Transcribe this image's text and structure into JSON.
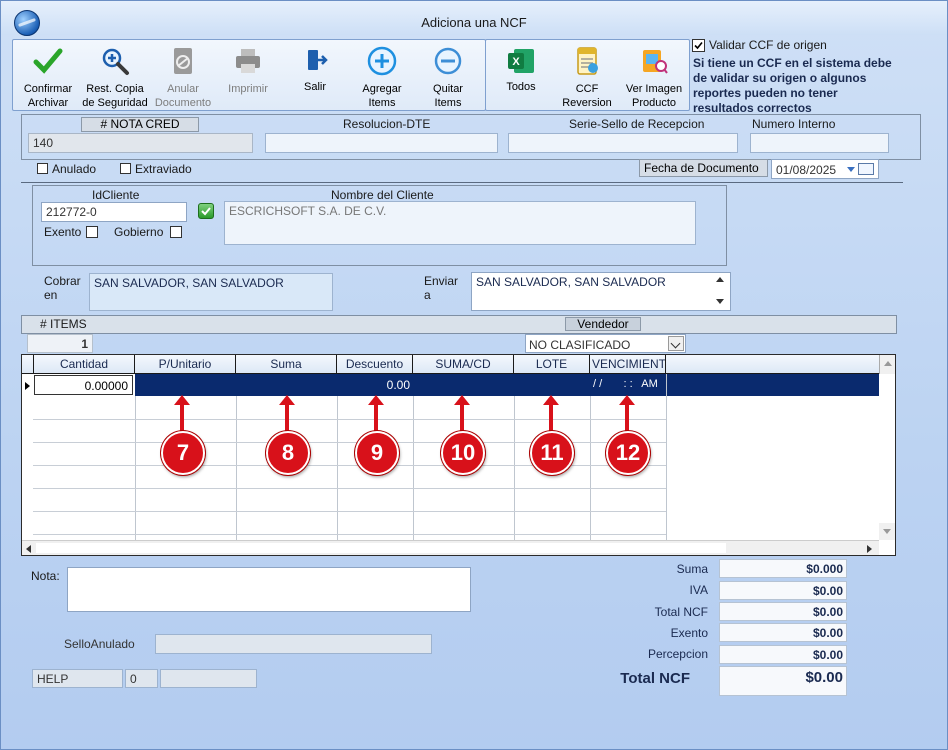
{
  "window": {
    "title": "Adiciona una NCF"
  },
  "toolbar": {
    "buttons": [
      {
        "label1": "Confirmar",
        "label2": "Archivar"
      },
      {
        "label1": "Rest. Copia",
        "label2": "de Seguridad"
      },
      {
        "label1": "Anular",
        "label2": "Documento"
      },
      {
        "label1": "Imprimir",
        "label2": ""
      },
      {
        "label1": "Salir",
        "label2": ""
      },
      {
        "label1": "Agregar",
        "label2": "Items"
      },
      {
        "label1": "Quitar",
        "label2": "Items"
      }
    ],
    "export_buttons": [
      {
        "label1": "Todos",
        "label2": ""
      },
      {
        "label1": "CCF",
        "label2": "Reversion"
      },
      {
        "label1": "Ver Imagen",
        "label2": "Producto"
      }
    ]
  },
  "validate": {
    "checkbox_label": "Validar CCF de origen",
    "warning": "Si tiene un CCF en el sistema debe de validar su origen o algunos reportes pueden no tener resultados correctos"
  },
  "doc": {
    "nota_label": "# NOTA CRED",
    "nota_value": "140",
    "resolucion_label": "Resolucion-DTE",
    "serie_label": "Serie-Sello de Recepcion",
    "numero_label": "Numero Interno",
    "anulado_label": "Anulado",
    "extraviado_label": "Extraviado",
    "fecha_label": "Fecha de  Documento",
    "fecha_value": "01/08/2025"
  },
  "client": {
    "id_label": "IdCliente",
    "id_value": "212772-0",
    "name_label": "Nombre del Cliente",
    "name_value": "ESCRICHSOFT S.A. DE C.V.",
    "exento_label": "Exento",
    "gobierno_label": "Gobierno",
    "cobrar_label1": "Cobrar",
    "cobrar_label2": "en",
    "cobrar_value": "SAN SALVADOR, SAN SALVADOR",
    "enviar_label1": "Enviar",
    "enviar_label2": "a",
    "enviar_value": "SAN SALVADOR, SAN SALVADOR"
  },
  "items_bar": {
    "items_label": "# ITEMS",
    "items_count": "1",
    "vendedor_label": "Vendedor",
    "vendedor_value": "NO CLASIFICADO"
  },
  "grid": {
    "columns": [
      "Cantidad",
      "P/Unitario",
      "Suma",
      "Descuento",
      "SUMA/CD",
      "LOTE",
      "VENCIMIENTO"
    ],
    "row": {
      "cantidad": "0.00000",
      "descuento": "0.00",
      "vencimiento": "/ /       : :   AM"
    }
  },
  "markers": [
    "7",
    "8",
    "9",
    "10",
    "11",
    "12"
  ],
  "footer": {
    "nota_label": "Nota:",
    "sello_label": "SelloAnulado",
    "help_label": "HELP",
    "help_value": "0"
  },
  "totals": {
    "suma_label": "Suma",
    "suma_value": "$0.000",
    "iva_label": "IVA",
    "iva_value": "$0.00",
    "total_ncf_label": "Total NCF",
    "total_ncf_value": "$0.00",
    "exento_label": "Exento",
    "exento_value": "$0.00",
    "percepcion_label": "Percepcion",
    "percepcion_value": "$0.00",
    "grand_label": "Total NCF",
    "grand_value": "$0.00"
  },
  "colors": {
    "accent": "#d8111a",
    "selected_row": "#0a2a6e"
  }
}
